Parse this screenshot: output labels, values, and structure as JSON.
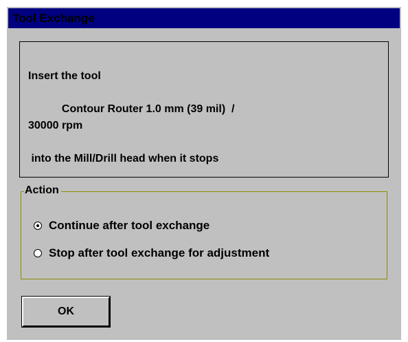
{
  "window": {
    "title": "Tool Exchange"
  },
  "message": {
    "line1": "Insert the tool",
    "line2": "           Contour Router 1.0 mm (39 mil)  /",
    "line3": "30000 rpm",
    "line4": " into the Mill/Drill head when it stops"
  },
  "action_group": {
    "label": "Action",
    "options": [
      {
        "label": "Continue after tool exchange",
        "checked": true
      },
      {
        "label": "Stop after tool exchange for adjustment",
        "checked": false
      }
    ]
  },
  "buttons": {
    "ok_label": "OK"
  },
  "colors": {
    "titlebar": "#000080",
    "dialog_background": "#c0c0c0",
    "group_border": "#8a8a00"
  }
}
